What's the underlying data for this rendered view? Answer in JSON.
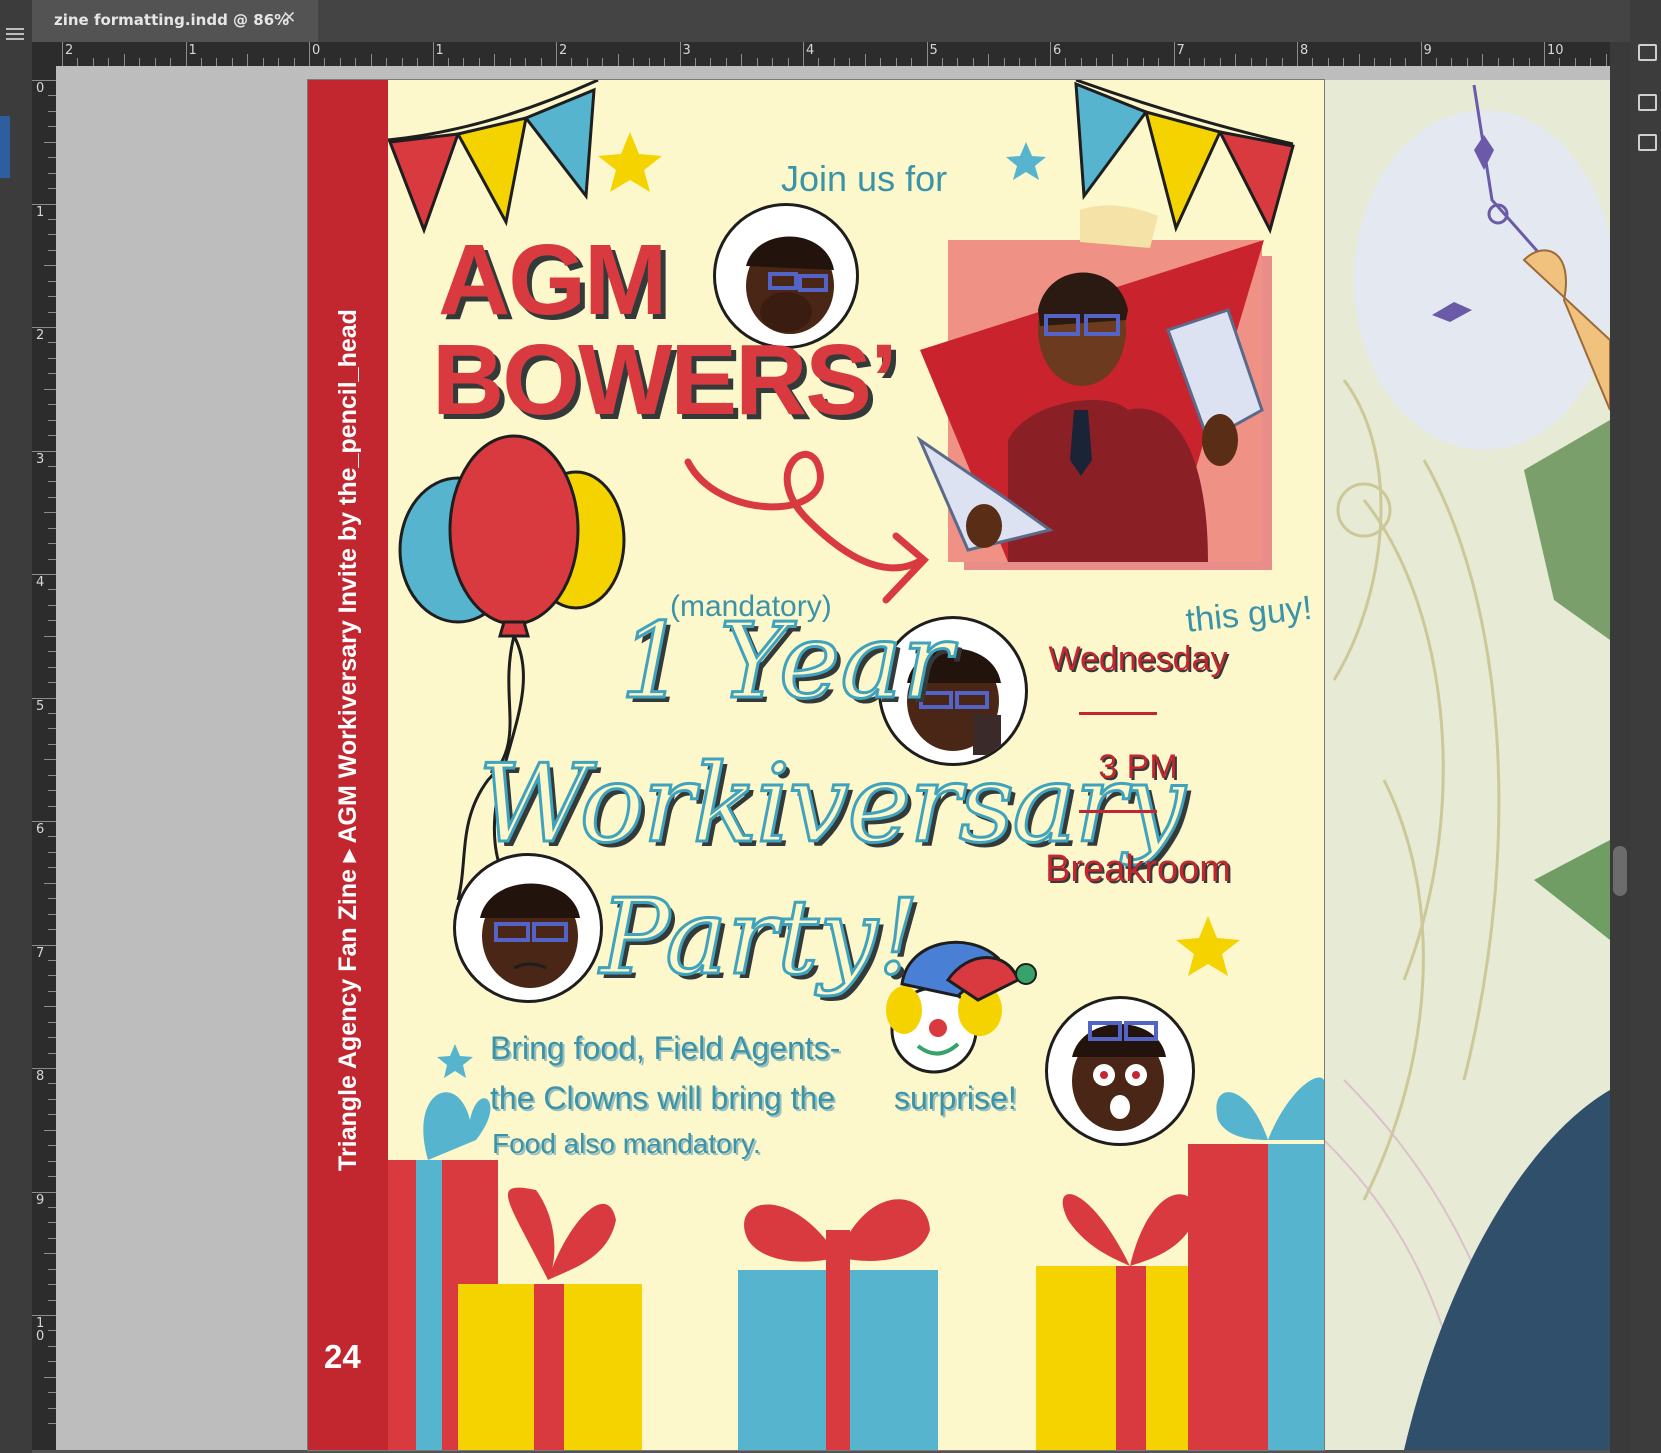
{
  "window": {
    "tab_title": "zine formatting.indd @ 86%",
    "tab_close": "✕"
  },
  "rulers": {
    "horizontal_labels": [
      "2",
      "1",
      "0",
      "1",
      "2",
      "3",
      "4",
      "5",
      "6",
      "7",
      "8",
      "9",
      "10"
    ],
    "vertical_labels": [
      "0",
      "1",
      "2",
      "3",
      "4",
      "5",
      "6",
      "7",
      "8",
      "9",
      "10"
    ]
  },
  "page": {
    "number": "24",
    "sidebar_text": "Triangle Agency Fan Zine ▸ AGM Workiversary Invite by the_pencil_head",
    "intro": "Join us for",
    "name_line1": "AGM",
    "name_line2": "BOWERS’",
    "mandatory": "(mandatory)",
    "arrow_note": "this guy!",
    "title_line1": "1 Year",
    "title_line2": "Workiversary",
    "title_line3": "Party!",
    "day": "Wednesday",
    "time": "3 PM",
    "location": "Breakroom",
    "note_line1": "Bring food, Field Agents-",
    "note_line2": "the Clowns will bring the",
    "note_surprise": "surprise!",
    "note_line3": "Food also mandatory."
  },
  "colors": {
    "paper": "#fdf7cc",
    "red": "#c2262f",
    "party_red": "#d83a3f",
    "blue": "#3fa3bd",
    "yellow": "#f4d300",
    "text_blue": "#3b93a8"
  }
}
